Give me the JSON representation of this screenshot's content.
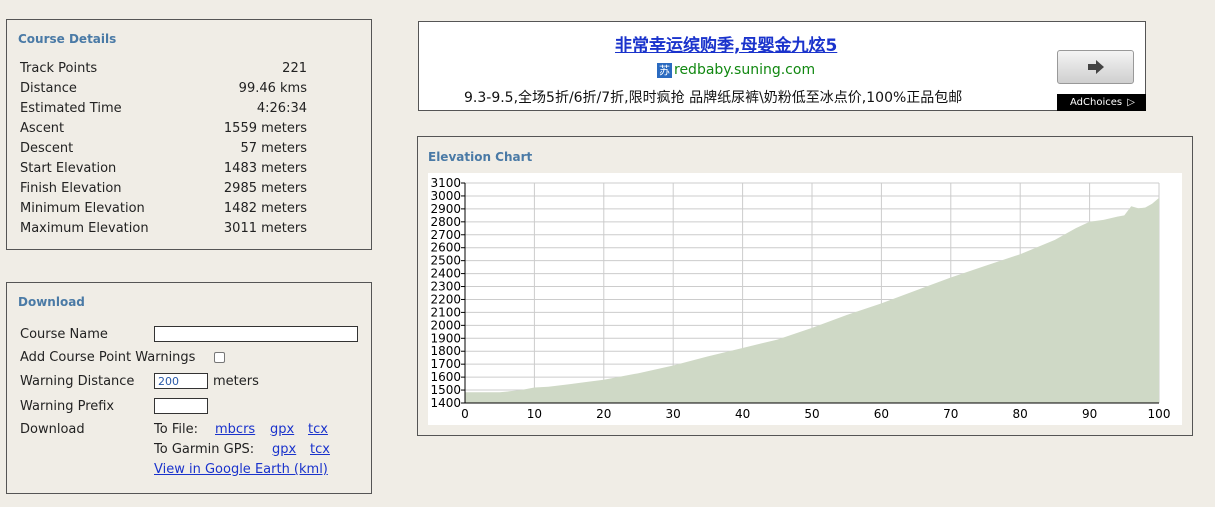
{
  "course_details": {
    "title": "Course Details",
    "rows": [
      {
        "label": "Track Points",
        "value": "221"
      },
      {
        "label": "Distance",
        "value": "99.46 kms"
      },
      {
        "label": "Estimated Time",
        "value": "4:26:34"
      },
      {
        "label": "Ascent",
        "value": "1559 meters"
      },
      {
        "label": "Descent",
        "value": "57 meters"
      },
      {
        "label": "Start Elevation",
        "value": "1483 meters"
      },
      {
        "label": "Finish Elevation",
        "value": "2985 meters"
      },
      {
        "label": "Minimum Elevation",
        "value": "1482 meters"
      },
      {
        "label": "Maximum Elevation",
        "value": "3011 meters"
      }
    ]
  },
  "download": {
    "title": "Download",
    "course_name_label": "Course Name",
    "course_name_value": "",
    "warnings_label": "Add Course Point Warnings",
    "warning_distance_label": "Warning Distance",
    "warning_distance_value": "200",
    "warning_distance_unit": "meters",
    "warning_prefix_label": "Warning Prefix",
    "warning_prefix_value": "",
    "download_label": "Download",
    "to_file_label": "To File:",
    "to_file_links": [
      "mbcrs",
      "gpx",
      "tcx"
    ],
    "to_garmin_label": "To Garmin GPS:",
    "to_garmin_links": [
      "gpx",
      "tcx"
    ],
    "google_earth_link": "View in Google Earth (kml)"
  },
  "ad": {
    "headline": "非常幸运缤购季,母婴金九炫5",
    "logo_glyph": "苏",
    "domain": "redbaby.suning.com",
    "body": "9.3-9.5,全场5折/6折/7折,限时疯抢 品牌纸尿裤\\奶粉低至冰点价,100%正品包邮",
    "adchoices": "AdChoices",
    "arrow_icon": "arrow-right-icon"
  },
  "elevation_chart_title": "Elevation Chart",
  "chart_data": {
    "type": "area",
    "x_ticks": [
      "0",
      "10",
      "20",
      "30",
      "40",
      "50",
      "60",
      "70",
      "80",
      "90",
      "100"
    ],
    "y_ticks": [
      "1400",
      "1500",
      "1600",
      "1700",
      "1800",
      "1900",
      "2000",
      "2100",
      "2200",
      "2300",
      "2400",
      "2500",
      "2600",
      "2700",
      "2800",
      "2900",
      "3000",
      "3100"
    ],
    "xlim": [
      0,
      100
    ],
    "ylim": [
      1400,
      3100
    ],
    "grid": true,
    "fill_color": "#cfd9c6",
    "x": [
      0,
      5,
      8,
      10,
      12,
      15,
      20,
      25,
      30,
      35,
      40,
      45,
      50,
      55,
      60,
      65,
      70,
      75,
      80,
      85,
      88,
      90,
      92,
      94,
      95,
      96,
      97,
      98,
      99,
      100
    ],
    "y": [
      1483,
      1483,
      1500,
      1520,
      1525,
      1545,
      1580,
      1630,
      1690,
      1760,
      1825,
      1890,
      1980,
      2080,
      2170,
      2270,
      2370,
      2460,
      2550,
      2660,
      2750,
      2800,
      2815,
      2840,
      2850,
      2920,
      2905,
      2910,
      2940,
      2985
    ]
  }
}
